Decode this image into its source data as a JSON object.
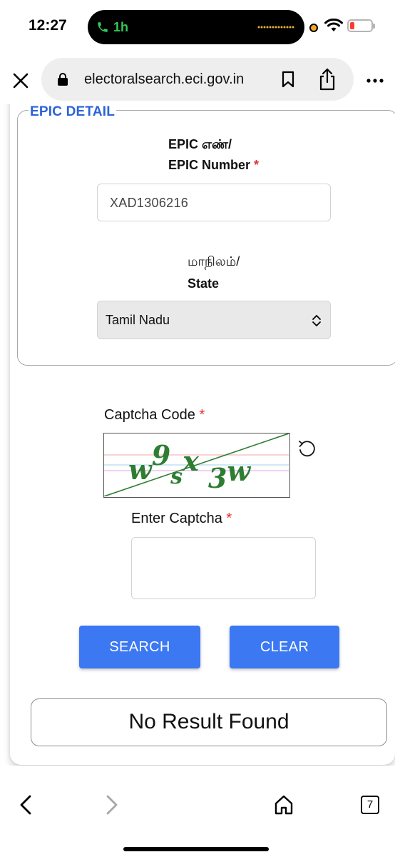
{
  "status_bar": {
    "time": "12:27",
    "call_duration": "1h"
  },
  "browser": {
    "url": "electoralsearch.eci.gov.in",
    "tab_count": "7"
  },
  "form": {
    "legend": "EPIC DETAIL",
    "epic_label_ta": "EPIC எண்/",
    "epic_label_en": "EPIC Number",
    "required_mark": "*",
    "epic_value": "XAD1306216",
    "state_label_ta": "மாநிலம்/",
    "state_label_en": "State",
    "state_value": "Tamil Nadu",
    "captcha_label": "Captcha Code",
    "captcha_text": "w9sx3w",
    "enter_captcha_label": "Enter Captcha",
    "enter_captcha_value": "",
    "search_button": "SEARCH",
    "clear_button": "CLEAR"
  },
  "result": {
    "message": "No Result Found"
  },
  "colors": {
    "accent": "#3b78f2",
    "legend": "#2b63d9",
    "required": "#e03131",
    "captcha_text": "#2e7d32"
  }
}
